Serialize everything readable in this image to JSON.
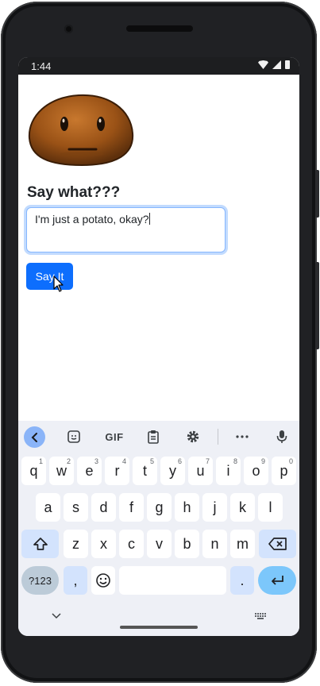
{
  "status_bar": {
    "time": "1:44"
  },
  "app": {
    "prompt": "Say what???",
    "input_value": "I'm just a potato, okay?",
    "button_label": "Say It"
  },
  "keyboard": {
    "toolbar": {
      "gif_label": "GIF"
    },
    "row1": [
      {
        "key": "q",
        "hint": "1"
      },
      {
        "key": "w",
        "hint": "2"
      },
      {
        "key": "e",
        "hint": "3"
      },
      {
        "key": "r",
        "hint": "4"
      },
      {
        "key": "t",
        "hint": "5"
      },
      {
        "key": "y",
        "hint": "6"
      },
      {
        "key": "u",
        "hint": "7"
      },
      {
        "key": "i",
        "hint": "8"
      },
      {
        "key": "o",
        "hint": "9"
      },
      {
        "key": "p",
        "hint": "0"
      }
    ],
    "row2": [
      "a",
      "s",
      "d",
      "f",
      "g",
      "h",
      "j",
      "k",
      "l"
    ],
    "row3": [
      "z",
      "x",
      "c",
      "v",
      "b",
      "n",
      "m"
    ],
    "symbols_label": "?123",
    "comma_label": ",",
    "period_label": "."
  },
  "colors": {
    "accent": "#0d6efd",
    "keyboard_bg": "#eef0f6",
    "enter_key": "#7cc7fb"
  },
  "icons": [
    "wifi-icon",
    "cell-signal-icon",
    "battery-icon",
    "back-icon",
    "sticker-icon",
    "clipboard-icon",
    "gear-icon",
    "more-icon",
    "mic-icon",
    "shift-icon",
    "backspace-icon",
    "emoji-icon",
    "enter-icon",
    "chevron-down-icon",
    "keyboard-icon",
    "mouse-cursor-icon"
  ]
}
